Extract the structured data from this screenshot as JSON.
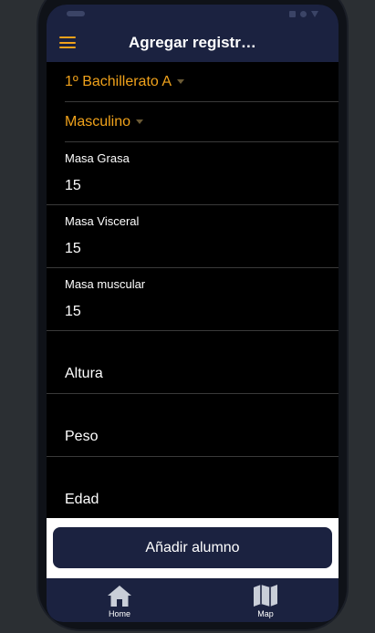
{
  "appbar": {
    "title": "Agregar registr…"
  },
  "form": {
    "group_select": "1º Bachillerato A",
    "gender_select": "Masculino",
    "fields": [
      {
        "label": "Masa Grasa",
        "value": "15"
      },
      {
        "label": "Masa Visceral",
        "value": "15"
      },
      {
        "label": "Masa muscular",
        "value": "15"
      }
    ],
    "placeholders": [
      "Altura",
      "Peso",
      "Edad"
    ]
  },
  "action": {
    "add_label": "Añadir alumno"
  },
  "tabs": [
    {
      "label": "Home",
      "icon": "home-icon"
    },
    {
      "label": "Map",
      "icon": "map-icon"
    }
  ],
  "colors": {
    "accent": "#f0a21b",
    "bar": "#1b2240"
  }
}
